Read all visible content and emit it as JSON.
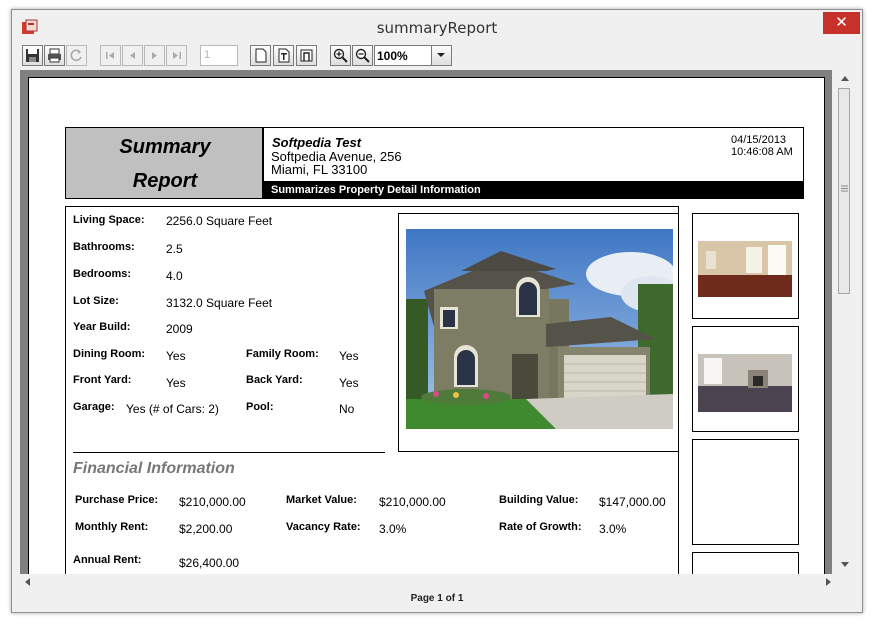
{
  "window": {
    "title": "summaryReport",
    "close_glyph": "✕"
  },
  "toolbar": {
    "page_number": "1",
    "zoom": "100%"
  },
  "status": {
    "page_label": "Page 1 of 1"
  },
  "report": {
    "title_line1": "Summary",
    "title_line2": "Report",
    "company": "Softpedia Test",
    "address1": "Softpedia Avenue, 256",
    "address2": "Miami, FL 33100",
    "date": "04/15/2013",
    "time": "10:46:08 AM",
    "subtitle": "Summarizes Property Detail Information",
    "details": {
      "living_space_label": "Living Space:",
      "living_space": "2256.0 Square Feet",
      "bathrooms_label": "Bathrooms:",
      "bathrooms": "2.5",
      "bedrooms_label": "Bedrooms:",
      "bedrooms": "4.0",
      "lot_size_label": "Lot Size:",
      "lot_size": "3132.0 Square Feet",
      "year_build_label": "Year Build:",
      "year_build": "2009",
      "dining_room_label": "Dining Room:",
      "dining_room": "Yes",
      "family_room_label": "Family Room:",
      "family_room": "Yes",
      "front_yard_label": "Front Yard:",
      "front_yard": "Yes",
      "back_yard_label": "Back Yard:",
      "back_yard": "Yes",
      "garage_label": "Garage:",
      "garage": "Yes (# of Cars: 2)",
      "pool_label": "Pool:",
      "pool": "No"
    },
    "financial": {
      "heading": "Financial Information",
      "purchase_price_label": "Purchase Price:",
      "purchase_price": "$210,000.00",
      "market_value_label": "Market Value:",
      "market_value": "$210,000.00",
      "building_value_label": "Building Value:",
      "building_value": "$147,000.00",
      "monthly_rent_label": "Monthly Rent:",
      "monthly_rent": "$2,200.00",
      "vacancy_rate_label": "Vacancy Rate:",
      "vacancy_rate": "3.0%",
      "rate_of_growth_label": "Rate of Growth:",
      "rate_of_growth": "3.0%",
      "annual_rent_label": "Annual Rent:",
      "annual_rent": "$26,400.00"
    }
  },
  "colors": {
    "close": "#c7312b",
    "viewport": "#808080",
    "header_gray": "#c0c0c0"
  }
}
